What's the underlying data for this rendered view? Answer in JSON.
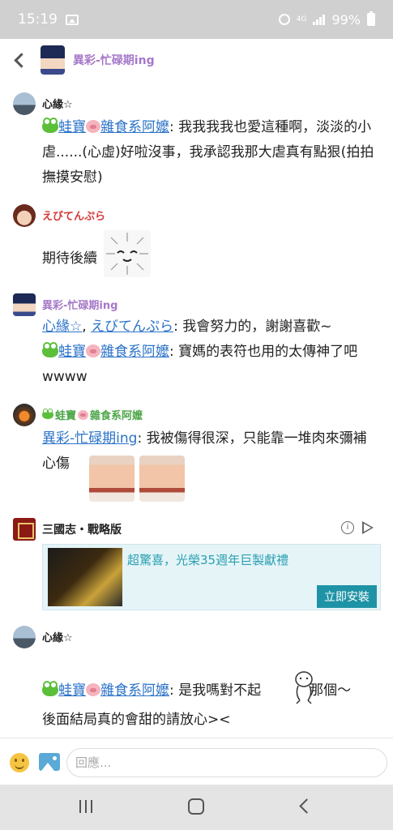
{
  "status_bar": {
    "time": "15:19",
    "network": "4G",
    "battery": "99%"
  },
  "header": {
    "back_icon": "chevron-left-icon",
    "title": "異彩-忙碌期ing"
  },
  "messages": [
    {
      "author": "心緣☆",
      "author_color": "#222222",
      "lines": {
        "mention": "蛙寶",
        "mention2": "雜食系阿嬤",
        "text": ": 我我我我也愛這種啊，淡淡的小虐......(心虛)好啦沒事，我承認我那大虐真有點狠(拍拍撫摸安慰)"
      }
    },
    {
      "author": "えびてんぷら",
      "author_color": "#d23a3a",
      "text": "期待後續"
    },
    {
      "author": "異彩-忙碌期ing",
      "author_color": "#a678c9",
      "mention_a": "心緣☆",
      "mention_b": "えびてんぷら",
      "text_1": ": 我會努力的，謝謝喜歡~",
      "mention_c": "蛙寶",
      "mention_d": "雜食系阿嬤",
      "text_2": ": 寶媽的表符也用的太傳神了吧wwww"
    },
    {
      "author": "蛙寶雜食系阿嬤",
      "author_a": "蛙寶",
      "author_b": "雜食系阿嬤",
      "author_color": "#4da64a",
      "mention": "異彩-忙碌期ing",
      "text": ": 我被傷得很深，只能靠一堆肉來彌補心傷"
    },
    {
      "author": "心緣☆",
      "author_color": "#222222",
      "mention_a": "蛙寶",
      "mention_b": "雜食系阿嬤",
      "text_1": ": 是我嗎對不起",
      "text_2": "那個～",
      "text_3": "後面結局真的會甜的請放心><"
    }
  ],
  "ad": {
    "app_name": "三國志・戰略版",
    "headline": "超驚喜，光榮35週年巨製獻禮",
    "install_label": "立即安裝"
  },
  "composer": {
    "placeholder": "回應..."
  },
  "colors": {
    "mention": "#2b73c8",
    "ad_accent": "#1f93a6",
    "header_name": "#a678c9"
  }
}
